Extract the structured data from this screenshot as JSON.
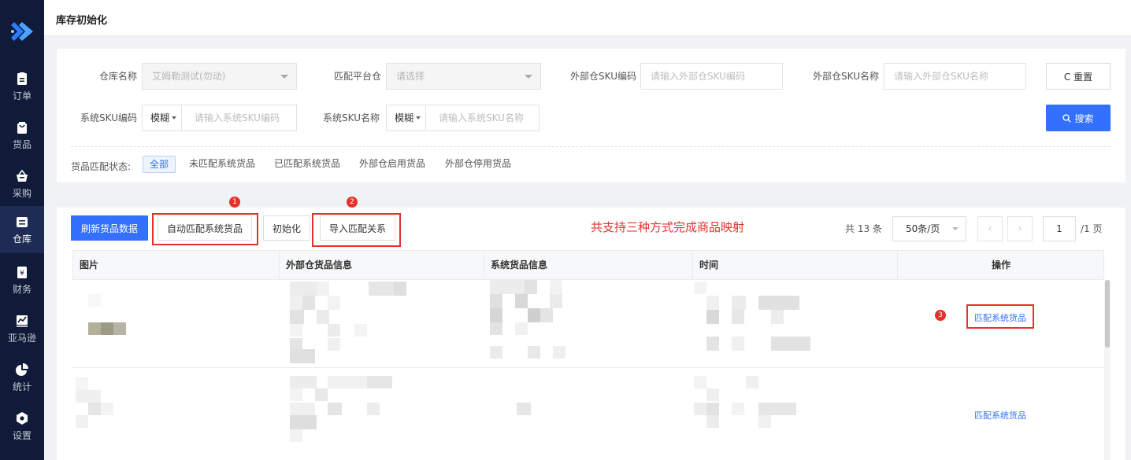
{
  "nav": {
    "items": [
      {
        "label": "订单",
        "icon": "clipboard-icon"
      },
      {
        "label": "货品",
        "icon": "bag-icon"
      },
      {
        "label": "采购",
        "icon": "basket-icon"
      },
      {
        "label": "仓库",
        "icon": "warehouse-icon",
        "active": true
      },
      {
        "label": "财务",
        "icon": "finance-icon"
      },
      {
        "label": "亚马逊",
        "icon": "trend-chart-icon"
      },
      {
        "label": "统计",
        "icon": "pie-chart-icon"
      },
      {
        "label": "设置",
        "icon": "settings-icon"
      }
    ]
  },
  "header": {
    "title": "库存初始化"
  },
  "filters": {
    "warehouse_name": {
      "label": "仓库名称",
      "value": "艾姆勒测试(勿动)"
    },
    "match_platform": {
      "label": "匹配平台仓",
      "placeholder": "请选择"
    },
    "ext_sku_code": {
      "label": "外部仓SKU编码",
      "placeholder": "请输入外部仓SKU编码"
    },
    "ext_sku_name": {
      "label": "外部仓SKU名称",
      "placeholder": "请输入外部仓SKU名称"
    },
    "sys_sku_code": {
      "label": "系统SKU编码",
      "mode": "模糊",
      "placeholder": "请输入系统SKU编码"
    },
    "sys_sku_name": {
      "label": "系统SKU名称",
      "mode": "模糊",
      "placeholder": "请输入系统SKU名称"
    },
    "reset_label": "C 重置",
    "search_label": "搜索",
    "status_label": "货品匹配状态:",
    "status_tabs": [
      "全部",
      "未匹配系统货品",
      "已匹配系统货品",
      "外部仓启用货品",
      "外部仓停用货品"
    ]
  },
  "toolbar": {
    "refresh": "刷新货品数据",
    "auto_match": "自动匹配系统货品",
    "init": "初始化",
    "import": "导入匹配关系",
    "marks": [
      "1",
      "2",
      "3"
    ],
    "note": "共支持三种方式完成商品映射"
  },
  "pagination": {
    "total": "共 13 条",
    "page_size": "50条/页",
    "prev": "‹",
    "next": "›",
    "current": "1",
    "of_pages": "/1 页"
  },
  "table": {
    "columns": [
      "图片",
      "外部仓货品信息",
      "系统货品信息",
      "时间",
      "操作"
    ],
    "rows": [
      {
        "action": "匹配系统货品"
      },
      {
        "action": "匹配系统货品"
      }
    ]
  },
  "colors": {
    "accent": "#3370ff",
    "annotation": "#e4322b",
    "sidebar": "#0f1b39"
  }
}
